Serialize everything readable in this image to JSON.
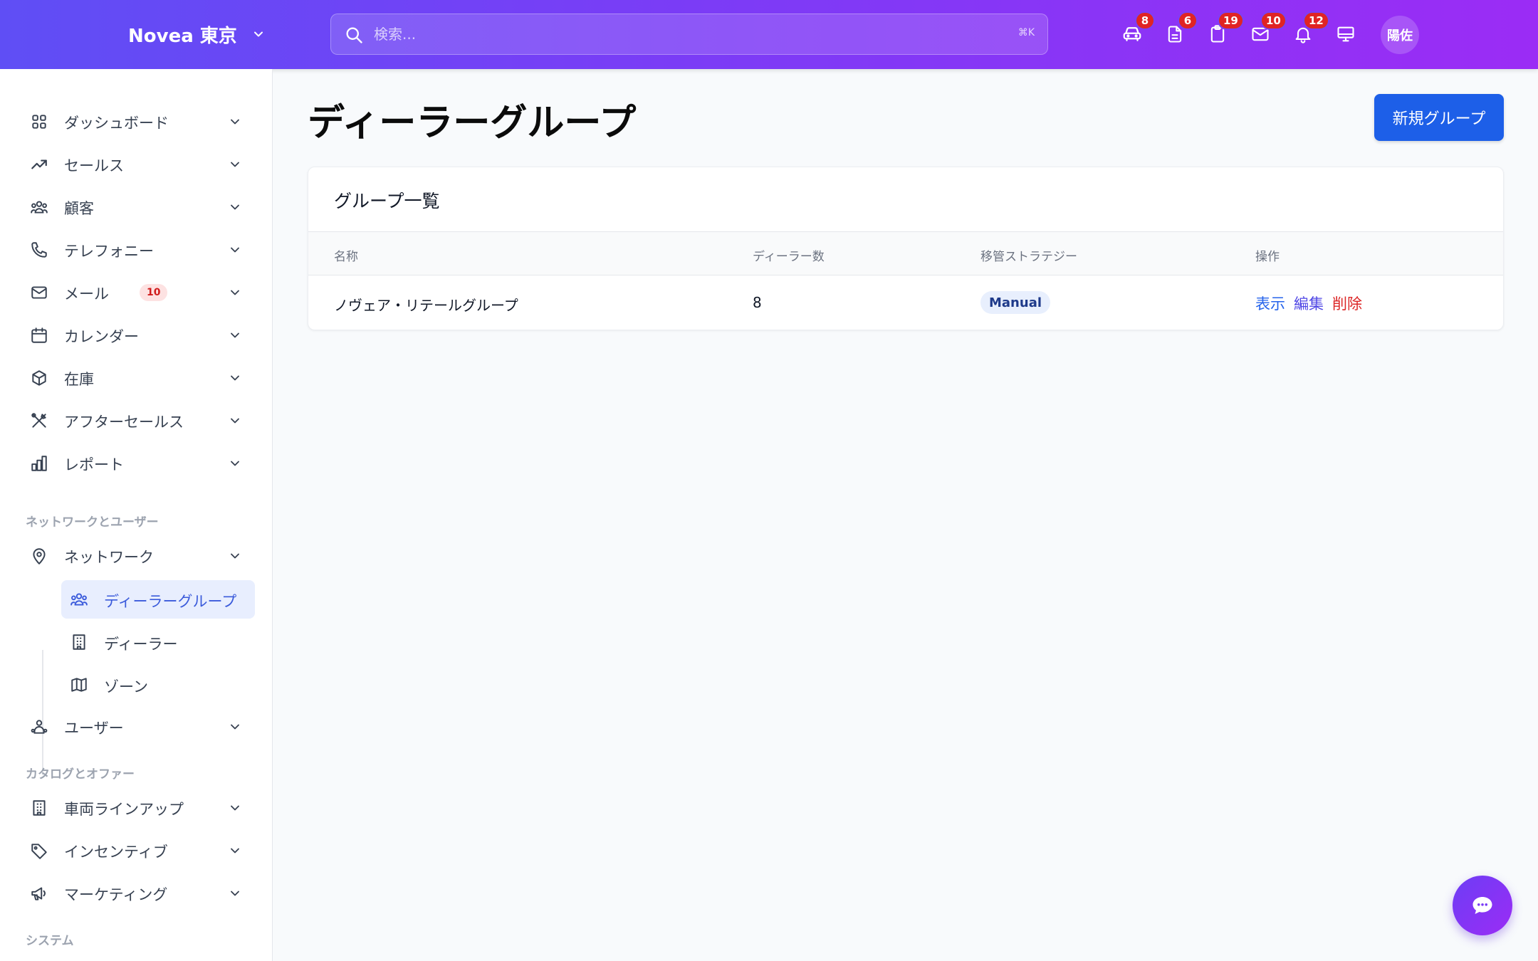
{
  "header": {
    "brand": "Novea 東京",
    "search_placeholder": "検索...",
    "search_shortcut": "⌘K",
    "icons": [
      {
        "name": "car-icon",
        "badge": "8"
      },
      {
        "name": "document-icon",
        "badge": "6"
      },
      {
        "name": "clipboard-icon",
        "badge": "19"
      },
      {
        "name": "mail-icon",
        "badge": "10"
      },
      {
        "name": "bell-icon",
        "badge": "12"
      },
      {
        "name": "monitor-icon",
        "badge": ""
      }
    ],
    "avatar": "陽佐"
  },
  "sidebar": {
    "items": [
      {
        "label": "ダッシュボード",
        "icon": "dashboard-grid-icon"
      },
      {
        "label": "セールス",
        "icon": "trending-up-icon"
      },
      {
        "label": "顧客",
        "icon": "users-icon"
      },
      {
        "label": "テレフォニー",
        "icon": "phone-icon"
      },
      {
        "label": "メール",
        "icon": "mail-icon",
        "badge": "10"
      },
      {
        "label": "カレンダー",
        "icon": "calendar-icon"
      },
      {
        "label": "在庫",
        "icon": "box-icon"
      },
      {
        "label": "アフターセールス",
        "icon": "tools-icon"
      },
      {
        "label": "レポート",
        "icon": "bar-chart-icon"
      }
    ],
    "section_network": "ネットワークとユーザー",
    "network": {
      "label": "ネットワーク",
      "icon": "map-pin-icon"
    },
    "network_sub": [
      {
        "label": "ディーラーグループ",
        "icon": "users-icon",
        "active": true
      },
      {
        "label": "ディーラー",
        "icon": "building-icon"
      },
      {
        "label": "ゾーン",
        "icon": "map-icon"
      }
    ],
    "users": {
      "label": "ユーザー",
      "icon": "user-group-icon"
    },
    "section_catalog": "カタログとオファー",
    "catalog_items": [
      {
        "label": "車両ラインアップ",
        "icon": "building-icon"
      },
      {
        "label": "インセンティブ",
        "icon": "tag-icon"
      },
      {
        "label": "マーケティング",
        "icon": "megaphone-icon"
      }
    ],
    "section_system": "システム"
  },
  "main": {
    "title": "ディーラーグループ",
    "new_button": "新規グループ",
    "card_title": "グループ一覧",
    "columns": [
      "名称",
      "ディーラー数",
      "移管ストラテジー",
      "操作"
    ],
    "rows": [
      {
        "name": "ノヴェア・リテールグループ",
        "dealers": "8",
        "strategy": "Manual",
        "actions": [
          "表示",
          "編集",
          "削除"
        ]
      }
    ]
  },
  "colors": {
    "header_gradient_start": "#5f4ef5",
    "header_gradient_end": "#9b2cf5",
    "primary": "#1d5fe8",
    "badge_red": "#e02424",
    "active_nav_bg": "#e8eefe"
  }
}
